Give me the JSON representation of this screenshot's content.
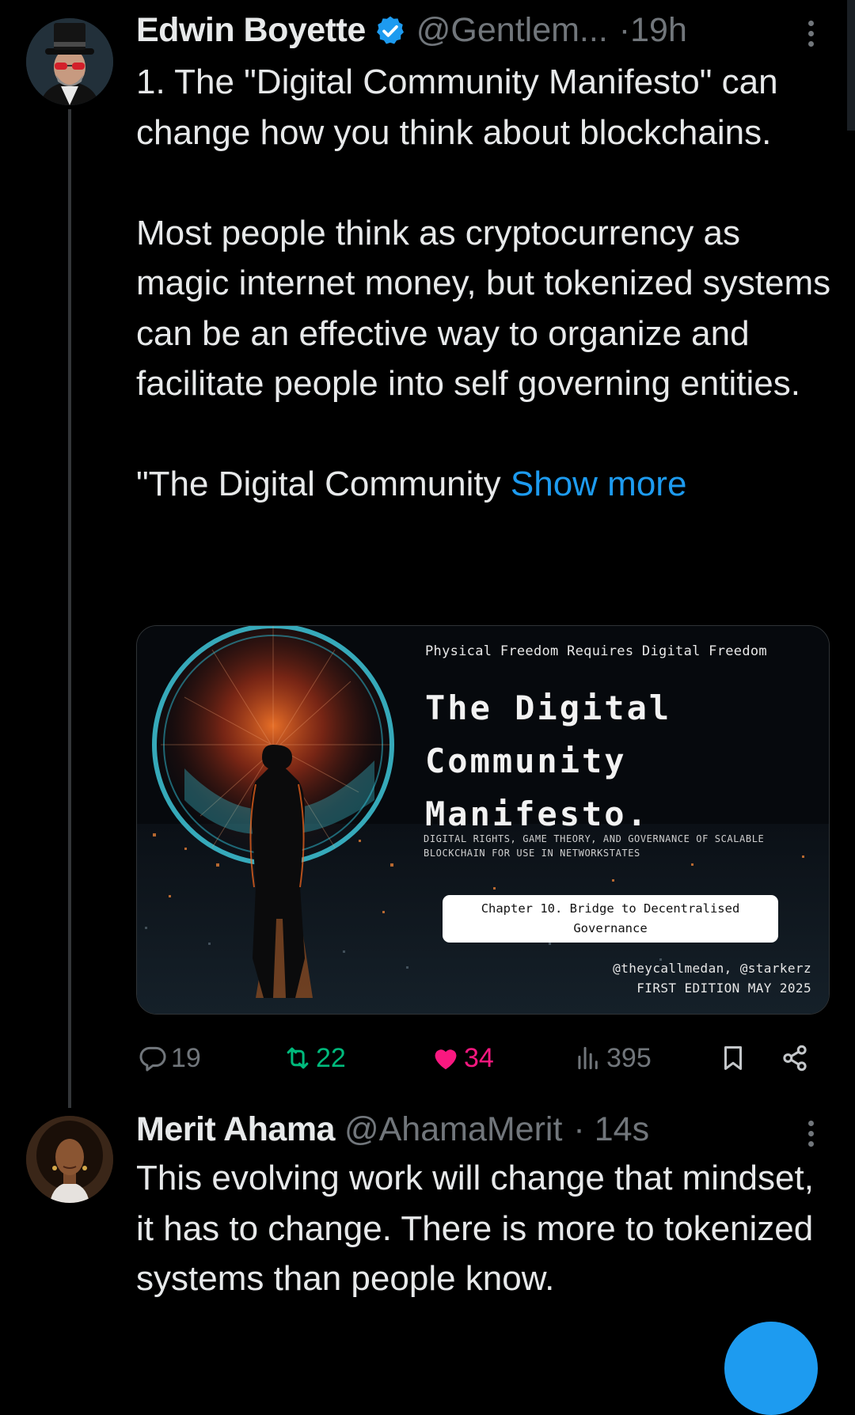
{
  "tweet": {
    "author_name": "Edwin Boyette",
    "author_handle": "@Gentlem...",
    "separator": "·",
    "time": "19h",
    "paragraphs": [
      "1. The \"Digital Community Manifesto\" can change how you think about blockchains.",
      "Most people think as cryptocurrency as magic internet money, but tokenized systems can be an effective way to organize and facilitate people into self governing entities.",
      "\"The Digital Community"
    ],
    "show_more": "Show more",
    "media": {
      "top_line": "Physical Freedom Requires Digital Freedom",
      "title_lines": [
        "The Digital",
        "Community",
        "Manifesto."
      ],
      "subtitle": "DIGITAL RIGHTS, GAME THEORY, AND GOVERNANCE OF SCALABLE BLOCKCHAIN FOR USE IN NETWORKSTATES",
      "chapter": "Chapter 10. Bridge to Decentralised Governance",
      "authors": "@theycallmedan, @starkerz",
      "edition": "FIRST EDITION MAY 2025"
    },
    "stats": {
      "replies": "19",
      "retweets": "22",
      "likes": "34",
      "views": "395"
    }
  },
  "reply": {
    "author_name": "Merit Ahama",
    "author_handle": "@AhamaMerit",
    "separator": "·",
    "time": "14s",
    "text": "This evolving work will change that mindset, it has to change. There is more to tokenized systems than people know."
  },
  "colors": {
    "background": "#000000",
    "text": "#e7e9ea",
    "secondary": "#71767b",
    "link": "#1d9bf0",
    "retweet": "#00ba7c",
    "like": "#f91880"
  },
  "icons": [
    "verified-badge-icon",
    "more-icon",
    "reply-icon",
    "retweet-icon",
    "like-icon",
    "views-icon",
    "bookmark-icon",
    "share-icon"
  ]
}
